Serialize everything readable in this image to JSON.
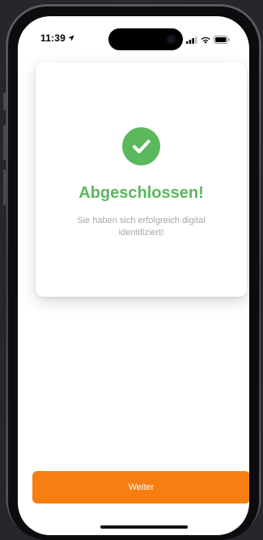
{
  "status_bar": {
    "time": "11:39"
  },
  "card": {
    "icon": "checkmark-circle-icon",
    "title": "Abgeschlossen!",
    "subtitle": "Sie haben sich erfolgreich digital identifiziert!"
  },
  "actions": {
    "continue_label": "Weiter"
  },
  "colors": {
    "success": "#5cb85c",
    "accent": "#f77e12",
    "muted_text": "#a7a7a7"
  }
}
